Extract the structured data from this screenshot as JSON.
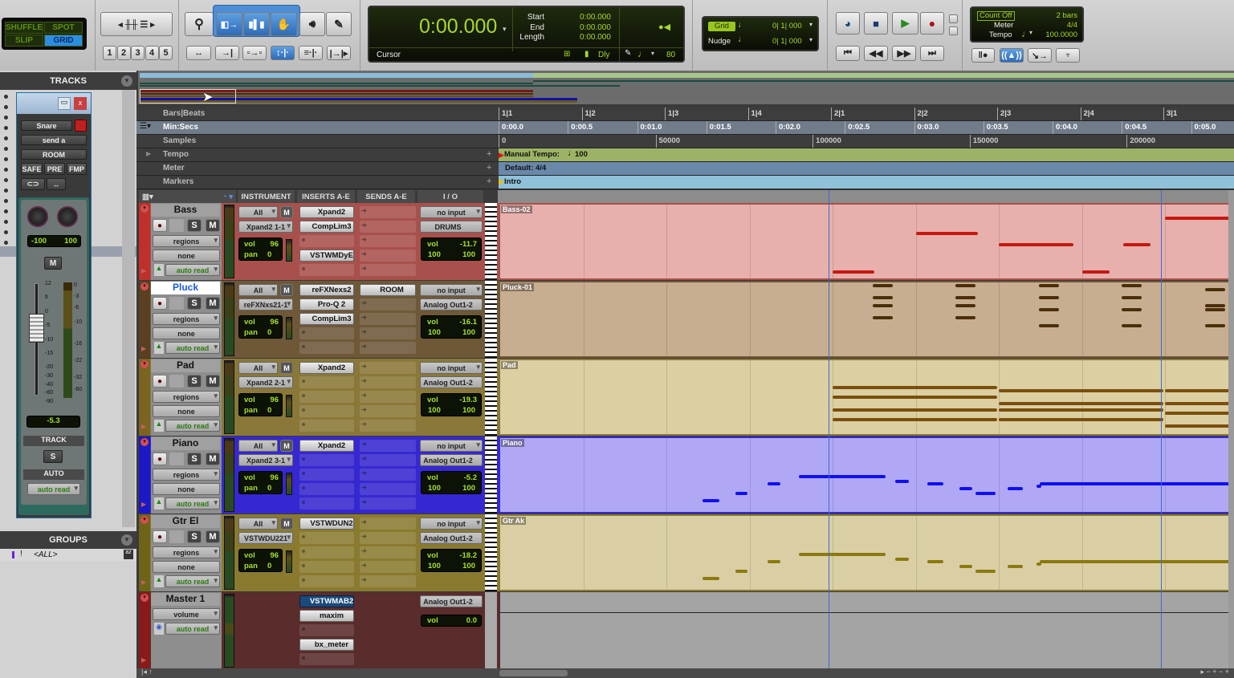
{
  "toolbar": {
    "modes": {
      "shuffle": "SHUFFLE",
      "spot": "SPOT",
      "slip": "SLIP",
      "grid": "GRID"
    },
    "zoom_presets": [
      "1",
      "2",
      "3",
      "4",
      "5"
    ],
    "tools": [
      "zoomer-icon",
      "trim-icon",
      "selector-icon",
      "grabber-icon",
      "scrubber-icon",
      "pencil-icon"
    ],
    "counter": {
      "main": "0:00.000",
      "start_label": "Start",
      "end_label": "End",
      "length_label": "Length",
      "start": "0:00.000",
      "end": "0:00.000",
      "length": "0:00.000",
      "cursor_label": "Cursor",
      "dly": "Dly",
      "nudge_value": "80"
    },
    "grid_nudge": {
      "grid_label": "Grid",
      "grid_value": "0| 1| 000",
      "nudge_label": "Nudge",
      "nudge_value": "0| 1| 000"
    },
    "count": {
      "count_off": "Count Off",
      "bars": "2 bars",
      "meter_label": "Meter",
      "meter": "4/4",
      "tempo_label": "Tempo",
      "tempo": "100.0000"
    }
  },
  "left": {
    "tracks_title": "TRACKS",
    "groups_title": "GROUPS",
    "groups_item": "<ALL>",
    "send_window": {
      "track": "Snare",
      "send": "send a",
      "dest": "ROOM",
      "safe": "SAFE",
      "pre": "PRE",
      "fmp": "FMP",
      "pan_l": "-100",
      "pan_r": "100",
      "mute": "M",
      "fader_value": "-5.3",
      "fader_scale": [
        "12",
        "6",
        "0",
        "-5",
        "-10",
        "-15",
        "-20",
        "-30",
        "-40",
        "-60",
        "-90"
      ],
      "meter_scale": [
        "0",
        "-3",
        "-6",
        "-10",
        "-16",
        "-22",
        "-32",
        "-60"
      ],
      "track_label": "TRACK",
      "solo": "S",
      "auto_label": "AUTO",
      "auto": "auto read"
    }
  },
  "rulers": {
    "labels": {
      "bars": "Bars|Beats",
      "minsecs": "Min:Secs",
      "samples": "Samples",
      "tempo": "Tempo",
      "meter": "Meter",
      "markers": "Markers"
    },
    "bars": [
      "1|1",
      "1|2",
      "1|3",
      "1|4",
      "2|1",
      "2|2",
      "2|3",
      "2|4",
      "3|1"
    ],
    "seconds": [
      "0:00.0",
      "0:00.5",
      "0:01.0",
      "0:01.5",
      "0:02.0",
      "0:02.5",
      "0:03.0",
      "0:03.5",
      "0:04.0",
      "0:04.5",
      "0:05.0"
    ],
    "samples": [
      "0",
      "50000",
      "100000",
      "150000",
      "200000"
    ],
    "tempo_text": "Manual Tempo:",
    "tempo_value": "100",
    "meter_text": "Default: 4/4",
    "marker_text": "Intro",
    "colors": {
      "tempo": "#9cb264",
      "meter": "#6a88aa",
      "markers": "#8fc1d9",
      "minsecs": "#717c8b"
    }
  },
  "columns": {
    "instrument": "INSTRUMENT",
    "inserts": "INSERTS A-E",
    "sends": "SENDS A-E",
    "io": "I / O"
  },
  "tracks": [
    {
      "name": "Bass",
      "strip": "#c0302b",
      "bg": "#a8504c",
      "clip": "#e8b0ac",
      "note": "#c41a10",
      "region": "Bass-02",
      "inst_in": "All",
      "inst": "Xpand2 1-1",
      "vol": "96",
      "pan": "0",
      "inserts": [
        "Xpand2",
        "CompLim3",
        "",
        "VSTWMDyE",
        ""
      ],
      "sends": [
        "",
        "",
        "",
        "",
        ""
      ],
      "io_in": "no input",
      "io_out": "DRUMS",
      "io_vol": "-11.7",
      "pan_l": "100",
      "pan_r": "100",
      "view": "regions",
      "group": "none",
      "auto": "auto read",
      "notes": [
        {
          "start": 4,
          "len": 0.5,
          "pitch": 36
        },
        {
          "start": 5,
          "len": 0.75,
          "pitch": 46
        },
        {
          "start": 6,
          "len": 0.9,
          "pitch": 43
        },
        {
          "start": 7,
          "len": 0.33,
          "pitch": 36
        },
        {
          "start": 7.5,
          "len": 0.33,
          "pitch": 43
        },
        {
          "start": 8,
          "len": 0.77,
          "pitch": 50
        }
      ]
    },
    {
      "name": "Pluck",
      "strip": "#5a4020",
      "bg": "#6e5838",
      "clip": "#c8ae90",
      "note": "#4a2f0a",
      "region": "Pluck-01",
      "inst_in": "All",
      "inst": "reFXNxs21-1",
      "vol": "96",
      "pan": "0",
      "inserts": [
        "reFXNexs2",
        "Pro-Q 2",
        "CompLim3",
        "",
        ""
      ],
      "sends": [
        "ROOM",
        "",
        "",
        "",
        ""
      ],
      "io_in": "no input",
      "io_out": "Analog Out1-2",
      "io_vol": "-16.1",
      "pan_l": "100",
      "pan_r": "100",
      "view": "regions",
      "group": "none",
      "auto": "auto read",
      "selected_name": true,
      "notes": [
        {
          "start": 4.48,
          "len": 0.24,
          "pitch": 80
        },
        {
          "start": 4.48,
          "len": 0.24,
          "pitch": 77
        },
        {
          "start": 4.48,
          "len": 0.24,
          "pitch": 75
        },
        {
          "start": 4.48,
          "len": 0.24,
          "pitch": 72
        },
        {
          "start": 5.48,
          "len": 0.24,
          "pitch": 80
        },
        {
          "start": 5.48,
          "len": 0.24,
          "pitch": 77
        },
        {
          "start": 5.48,
          "len": 0.24,
          "pitch": 75
        },
        {
          "start": 5.48,
          "len": 0.24,
          "pitch": 72
        },
        {
          "start": 6.48,
          "len": 0.24,
          "pitch": 80
        },
        {
          "start": 6.48,
          "len": 0.24,
          "pitch": 77
        },
        {
          "start": 6.48,
          "len": 0.24,
          "pitch": 74
        },
        {
          "start": 6.48,
          "len": 0.24,
          "pitch": 70
        },
        {
          "start": 7.48,
          "len": 0.24,
          "pitch": 80
        },
        {
          "start": 7.48,
          "len": 0.24,
          "pitch": 77
        },
        {
          "start": 7.48,
          "len": 0.24,
          "pitch": 74
        },
        {
          "start": 7.48,
          "len": 0.24,
          "pitch": 70
        },
        {
          "start": 8.48,
          "len": 0.24,
          "pitch": 79
        },
        {
          "start": 8.48,
          "len": 0.24,
          "pitch": 75
        },
        {
          "start": 8.48,
          "len": 0.24,
          "pitch": 74
        },
        {
          "start": 8.48,
          "len": 0.24,
          "pitch": 70
        }
      ]
    },
    {
      "name": "Pad",
      "strip": "#7a6420",
      "bg": "#8a7838",
      "clip": "#dccfa2",
      "note": "#7a4e0c",
      "region": "Pad",
      "inst_in": "All",
      "inst": "Xpand2 2-1",
      "vol": "96",
      "pan": "0",
      "inserts": [
        "Xpand2",
        "",
        "",
        "",
        ""
      ],
      "sends": [
        "",
        "",
        "",
        "",
        ""
      ],
      "io_in": "no input",
      "io_out": "Analog Out1-2",
      "io_vol": "-19.3",
      "pan_l": "100",
      "pan_r": "100",
      "view": "regions",
      "group": "none",
      "auto": "auto read",
      "notes": [
        {
          "start": 4,
          "len": 1.98,
          "pitch": 70
        },
        {
          "start": 4,
          "len": 1.98,
          "pitch": 67
        },
        {
          "start": 4,
          "len": 1.98,
          "pitch": 63
        },
        {
          "start": 4,
          "len": 1.98,
          "pitch": 60
        },
        {
          "start": 6,
          "len": 1.98,
          "pitch": 69
        },
        {
          "start": 6,
          "len": 1.98,
          "pitch": 65
        },
        {
          "start": 6,
          "len": 1.98,
          "pitch": 63
        },
        {
          "start": 6,
          "len": 1.98,
          "pitch": 60
        },
        {
          "start": 8,
          "len": 1,
          "pitch": 69
        },
        {
          "start": 8,
          "len": 1,
          "pitch": 65
        },
        {
          "start": 8,
          "len": 1,
          "pitch": 62
        },
        {
          "start": 8,
          "len": 1,
          "pitch": 58
        }
      ]
    },
    {
      "name": "Piano",
      "strip": "#1c18c8",
      "bg": "#3628d0",
      "clip": "#b0a8f4",
      "note": "#1010ee",
      "region": "Piano",
      "inst_in": "All",
      "inst": "Xpand2 3-1",
      "vol": "96",
      "pan": "0",
      "inserts": [
        "Xpand2",
        "",
        "",
        "",
        ""
      ],
      "sends": [
        "",
        "",
        "",
        "",
        ""
      ],
      "io_in": "no input",
      "io_out": "Analog Out1-2",
      "io_vol": "-5.2",
      "pan_l": "100",
      "pan_r": "100",
      "view": "regions",
      "group": "none",
      "auto": "auto read",
      "notes": [
        {
          "start": 2.43,
          "len": 0.21,
          "pitch": 60
        },
        {
          "start": 2.83,
          "len": 0.15,
          "pitch": 63
        },
        {
          "start": 3.22,
          "len": 0.15,
          "pitch": 67
        },
        {
          "start": 3.59,
          "len": 1.05,
          "pitch": 70
        },
        {
          "start": 4.75,
          "len": 0.17,
          "pitch": 68
        },
        {
          "start": 5.14,
          "len": 0.19,
          "pitch": 67
        },
        {
          "start": 5.53,
          "len": 0.15,
          "pitch": 65
        },
        {
          "start": 5.72,
          "len": 0.24,
          "pitch": 63
        },
        {
          "start": 6.11,
          "len": 0.18,
          "pitch": 65
        },
        {
          "start": 6.45,
          "len": 0.06,
          "pitch": 66
        },
        {
          "start": 6.49,
          "len": 2.3,
          "pitch": 67
        }
      ]
    },
    {
      "name": "Gtr El",
      "strip": "#6e6418",
      "bg": "#8a7a30",
      "clip": "#dacfa4",
      "note": "#8a7a10",
      "region": "Gtr Ak",
      "inst_in": "All",
      "inst": "VSTWDU221",
      "vol": "96",
      "pan": "0",
      "inserts": [
        "VSTWDUN2",
        "",
        "",
        "",
        ""
      ],
      "sends": [
        "",
        "",
        "",
        "",
        ""
      ],
      "io_in": "no input",
      "io_out": "Analog Out1-2",
      "io_vol": "-18.2",
      "pan_l": "100",
      "pan_r": "100",
      "view": "regions",
      "group": "none",
      "auto": "auto read",
      "notes": [
        {
          "start": 2.43,
          "len": 0.21,
          "pitch": 60
        },
        {
          "start": 2.83,
          "len": 0.15,
          "pitch": 63
        },
        {
          "start": 3.22,
          "len": 0.15,
          "pitch": 67
        },
        {
          "start": 3.59,
          "len": 1.05,
          "pitch": 70
        },
        {
          "start": 4.75,
          "len": 0.17,
          "pitch": 68
        },
        {
          "start": 5.14,
          "len": 0.19,
          "pitch": 67
        },
        {
          "start": 5.53,
          "len": 0.15,
          "pitch": 65
        },
        {
          "start": 5.72,
          "len": 0.24,
          "pitch": 63
        },
        {
          "start": 6.11,
          "len": 0.18,
          "pitch": 65
        },
        {
          "start": 6.45,
          "len": 0.06,
          "pitch": 66
        },
        {
          "start": 6.49,
          "len": 2.3,
          "pitch": 67
        }
      ]
    }
  ],
  "master": {
    "name": "Master 1",
    "bg": "#5a2c2c",
    "view": "volume",
    "auto": "auto read",
    "inserts": [
      "VSTWMAB2",
      "maxim",
      "",
      "bx_meter",
      ""
    ],
    "io_out": "Analog Out1-2",
    "vol_label": "vol",
    "vol": "0.0"
  },
  "labels": {
    "all": "All",
    "mute": "M",
    "solo": "S",
    "vol": "vol",
    "pan": "pan"
  }
}
